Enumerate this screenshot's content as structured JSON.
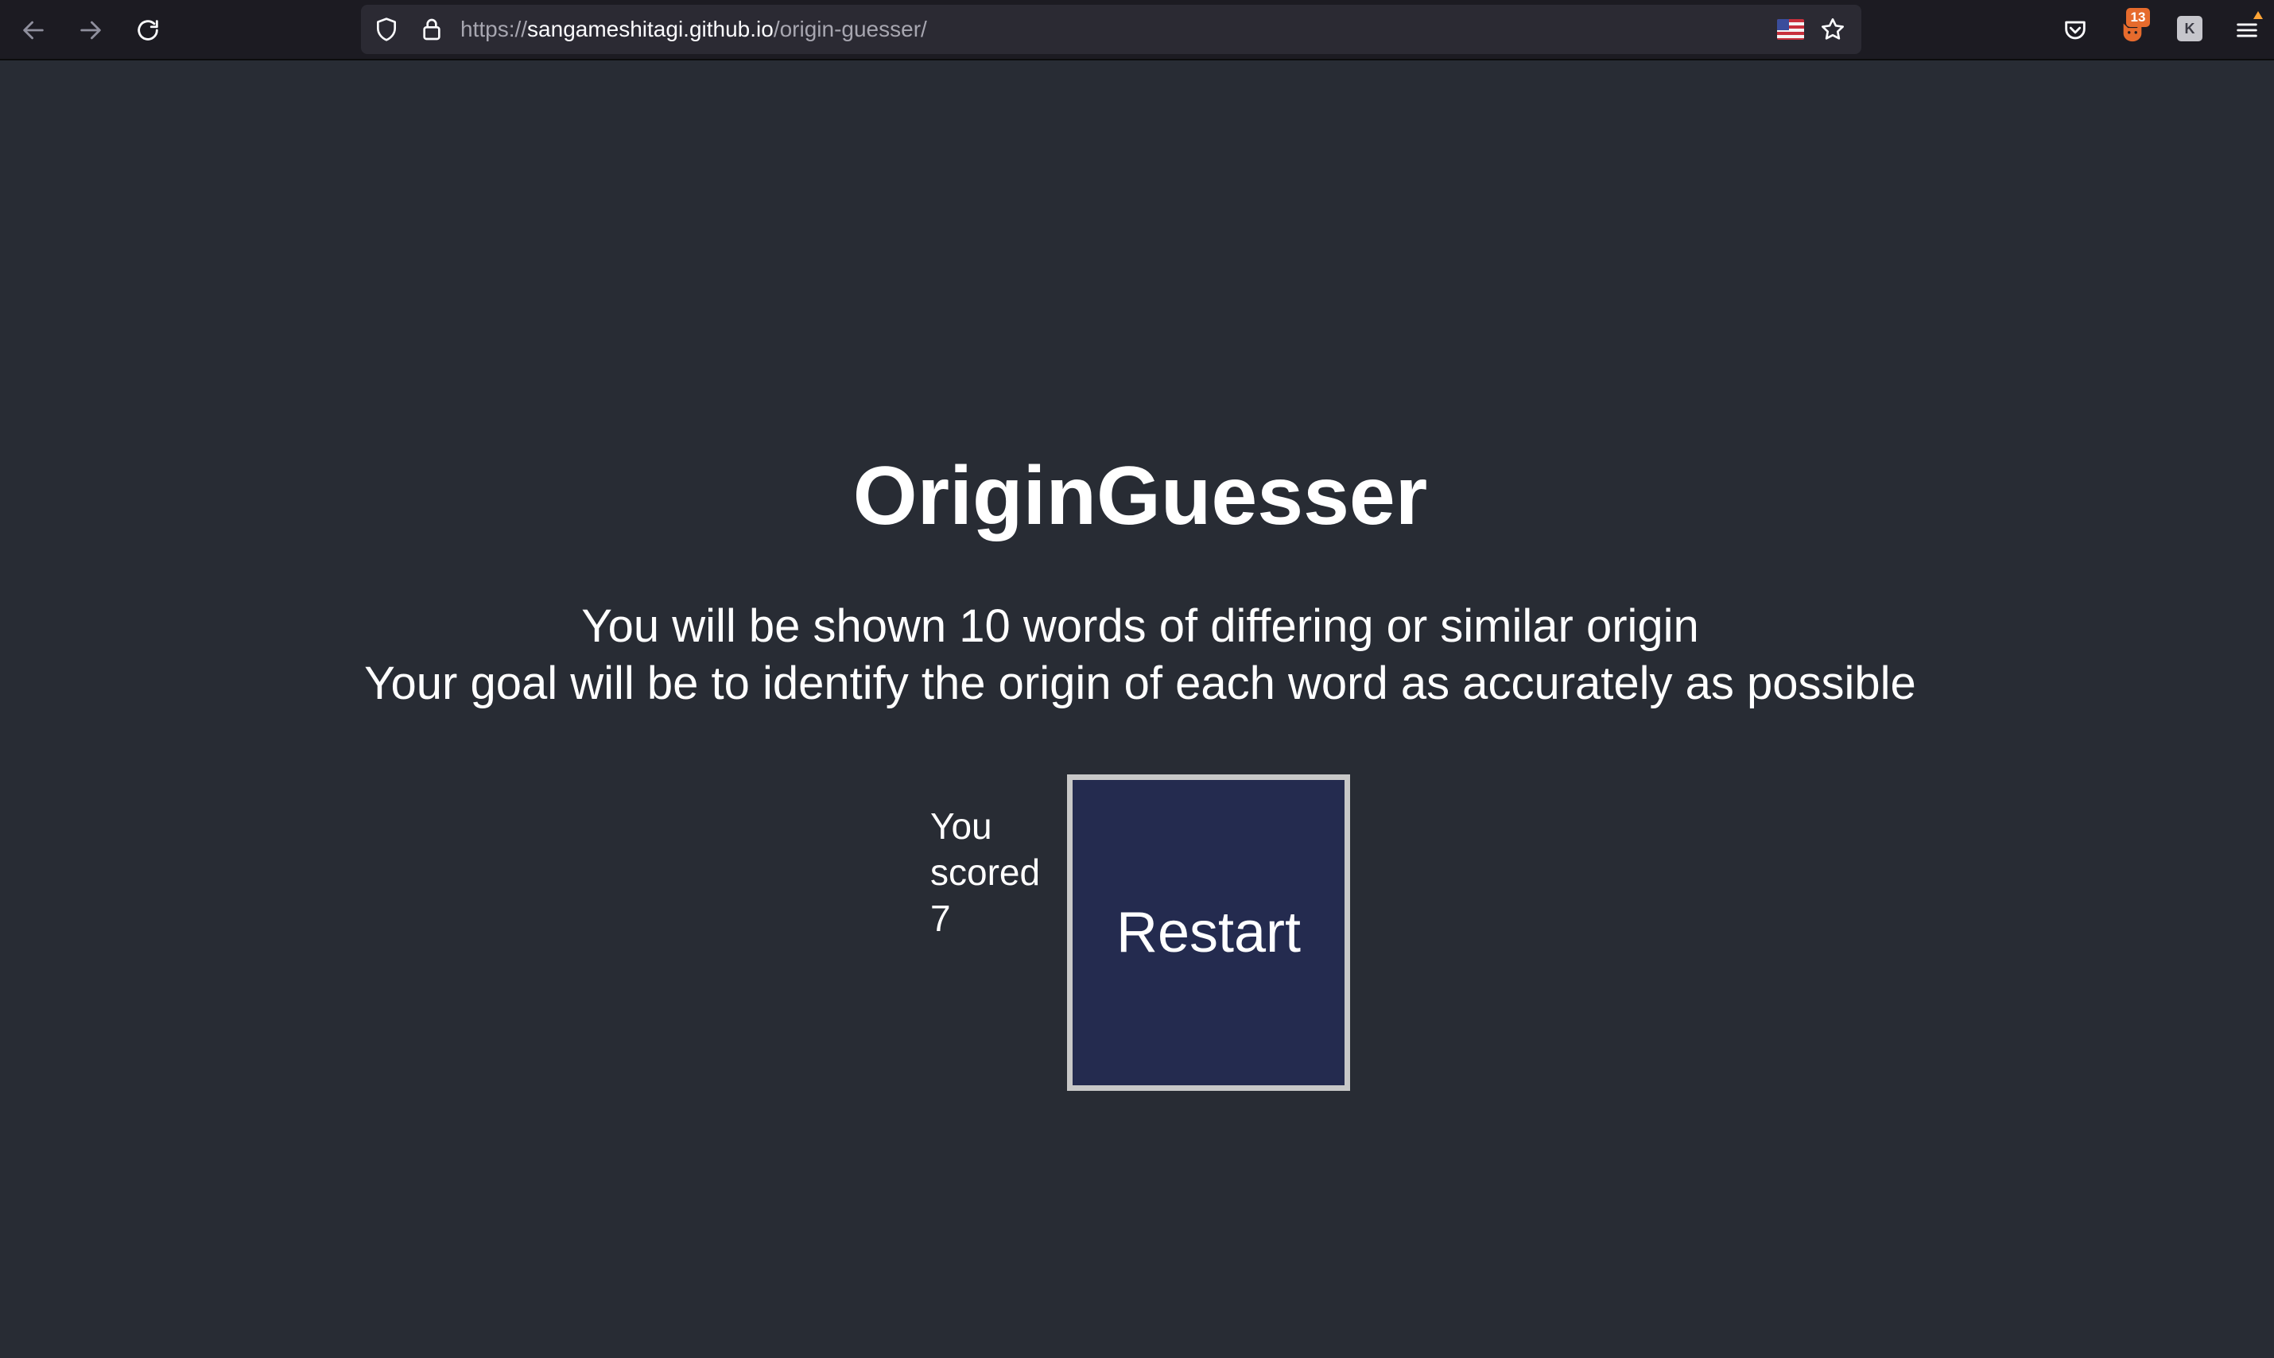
{
  "browser": {
    "url_prefix": "https://",
    "url_host": "sangameshitagi.github.io",
    "url_path": "/origin-guesser/",
    "extension_badge": "13",
    "extension_letter": "K",
    "icons": {
      "back": "arrow-left-icon",
      "forward": "arrow-right-icon",
      "reload": "reload-icon",
      "tracking": "shield-icon",
      "lock": "lock-icon",
      "flag": "us-flag-icon",
      "bookmark": "star-icon",
      "pocket": "pocket-icon",
      "extension": "fox-extension-icon",
      "menu": "hamburger-menu-icon"
    }
  },
  "page": {
    "title": "OriginGuesser",
    "description_line1": "You will be shown 10 words of differing or similar origin",
    "description_line2": "Your goal will be to identify the origin of each word as accurately as possible",
    "score_line1": "You",
    "score_line2": "scored",
    "score_line3": "7",
    "restart_label": "Restart"
  },
  "colors": {
    "page_background": "#282c34",
    "toolbar_background": "#1c1b22",
    "urlbar_background": "#2b2a33",
    "button_background": "#242b4f",
    "button_border": "#c8c8c8",
    "text": "#ffffff"
  }
}
